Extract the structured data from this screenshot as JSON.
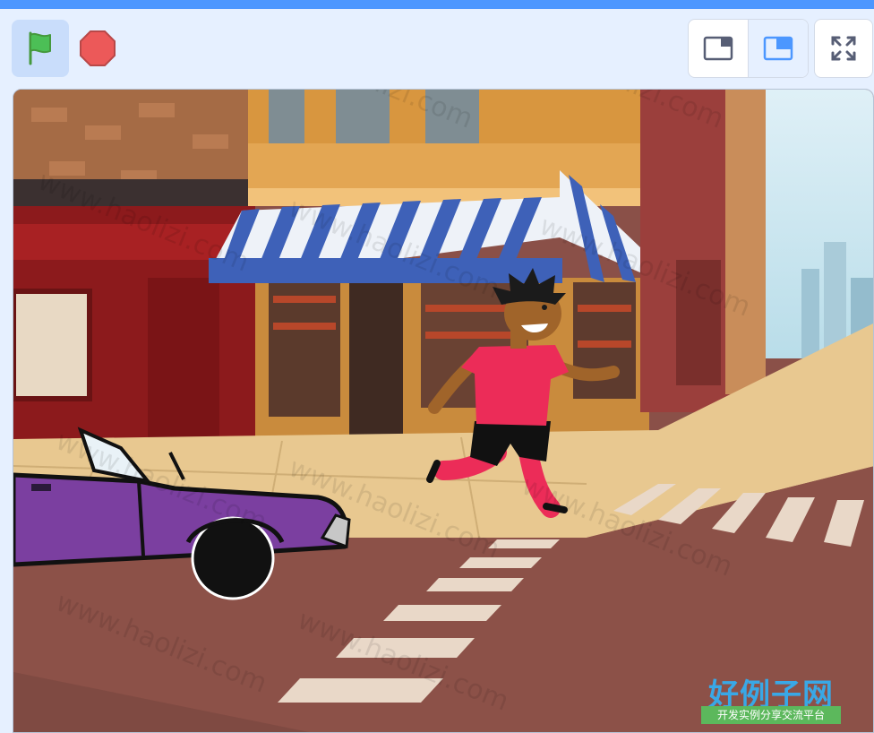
{
  "toolbar": {
    "green_flag": {
      "icon": "green-flag-icon",
      "color": "#4cbf56"
    },
    "stop": {
      "icon": "stop-sign-icon",
      "color": "#ec5959"
    },
    "layout_small": {
      "icon": "small-stage-icon",
      "selected": false
    },
    "layout_large": {
      "icon": "large-stage-icon",
      "selected": true
    },
    "fullscreen": {
      "icon": "fullscreen-icon"
    }
  },
  "stage": {
    "backdrop": "city street with shop, awning and crosswalk",
    "sprites": [
      {
        "name": "runner",
        "icon": "runner-sprite"
      },
      {
        "name": "car",
        "icon": "purple-convertible-sprite"
      }
    ]
  },
  "watermark": {
    "text": "www.haolizi.com",
    "logo_title": "好例子网",
    "logo_subtitle": "开发实例分享交流平台"
  },
  "colors": {
    "topbar": "#4c97ff",
    "control_bg": "#e6f0ff",
    "selected_layout": "#4c97ff"
  }
}
